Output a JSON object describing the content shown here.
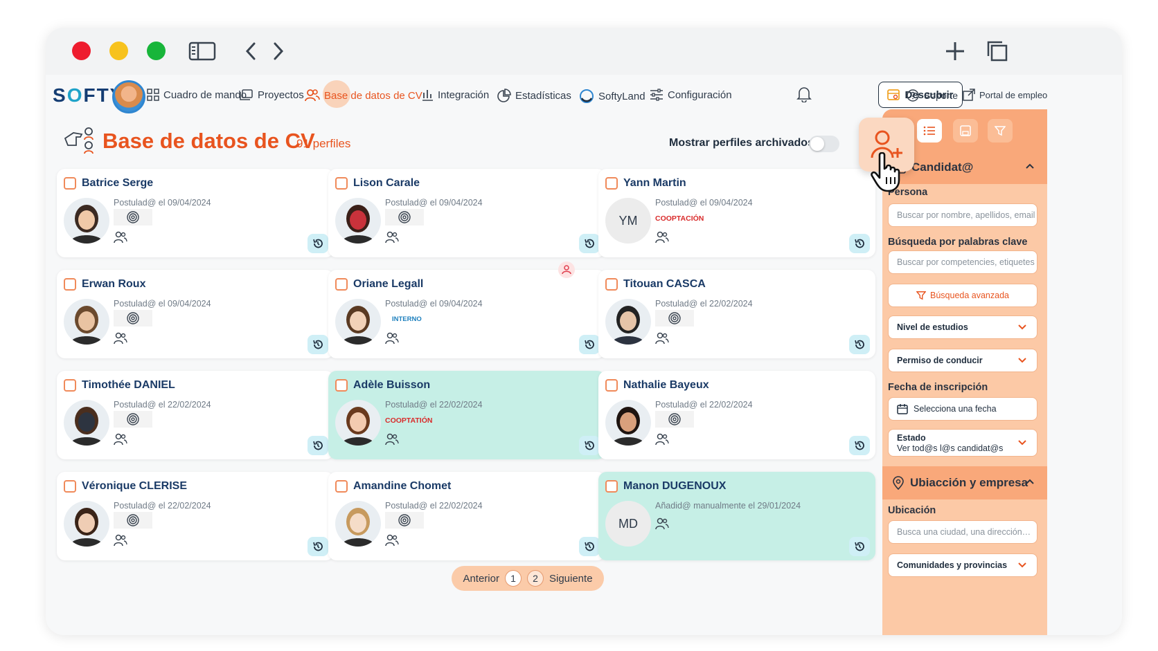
{
  "nav": {
    "logo": "SOFTY",
    "items": [
      {
        "label": "Cuadro de mando",
        "icon": "grid-icon"
      },
      {
        "label": "Proyectos",
        "icon": "folders-icon"
      },
      {
        "label": "Base de datos de CV",
        "icon": "users-icon",
        "active": true
      },
      {
        "label": "Integración",
        "icon": "bar-chart-icon"
      },
      {
        "label": "Estadísticas",
        "icon": "pie-chart-icon"
      },
      {
        "label": "SoftyLand",
        "icon": "softyland-icon"
      },
      {
        "label": "Configuración",
        "icon": "sliders-icon"
      }
    ],
    "descubrir": "Descubrir",
    "soporte": "Soporte",
    "portal": "Portal de empleo"
  },
  "page": {
    "title": "Base de datos de CV",
    "count": "91 perfiles",
    "archived_toggle_label": "Mostrar perfiles archivados"
  },
  "cards": [
    {
      "name": "Batrice Serge",
      "meta": "Postulad@ el 09/04/2024"
    },
    {
      "name": "Lison Carale",
      "meta": "Postulad@ el 09/04/2024"
    },
    {
      "name": "Yann Martin",
      "meta": "Postulad@ el 09/04/2024",
      "tag": "COOPTACIÓN",
      "initials": "YM"
    },
    {
      "name": "Erwan Roux",
      "meta": "Postulad@ el 09/04/2024"
    },
    {
      "name": "Oriane Legall",
      "meta": "Postulad@ el 09/04/2024",
      "tag": "INTERNO"
    },
    {
      "name": "Titouan CASCA",
      "meta": "Postulad@ el 22/02/2024"
    },
    {
      "name": "Timothée DANIEL",
      "meta": "Postulad@ el 22/02/2024"
    },
    {
      "name": "Adèle Buisson",
      "meta": "Postulad@ el 22/02/2024",
      "tag": "COOPTATIÓN"
    },
    {
      "name": "Nathalie Bayeux",
      "meta": "Postulad@ el 22/02/2024"
    },
    {
      "name": "Véronique CLERISE",
      "meta": "Postulad@ el 22/02/2024"
    },
    {
      "name": "Amandine Chomet",
      "meta": "Postulad@ el 22/02/2024"
    },
    {
      "name": "Manon DUGENOUX",
      "meta": "Añadid@ manualmente el 29/01/2024",
      "initials": "MD"
    }
  ],
  "pagination": {
    "prev": "Anterior",
    "pages": [
      "1",
      "2"
    ],
    "current": "1",
    "next": "Siguiente"
  },
  "panel": {
    "section_candidato": "Candidat@",
    "persona_label": "Persona",
    "persona_placeholder": "Buscar por nombre, apellidos, email",
    "keywords_label": "Búsqueda por palabras clave",
    "keywords_placeholder": "Buscar por competencies, etiquetes",
    "advanced": "Búsqueda avanzada",
    "nivel": "Nivel de estudios",
    "permiso": "Permiso de conducir",
    "fecha_label": "Fecha de inscripción",
    "fecha_placeholder": "Selecciona una fecha",
    "estado_label": "Estado",
    "estado_value": "Ver tod@s l@s candidat@s",
    "section_ubicacion": "Ubiacción y empresa",
    "ubicacion_label": "Ubicación",
    "ubicacion_placeholder": "Busca una ciudad, una dirección…",
    "comunidades": "Comunidades y provincias"
  },
  "colors": {
    "accent": "#e8541f",
    "navy": "#1a3a66",
    "teal_card": "#c6efe6",
    "panel": "#fcc9a6"
  }
}
